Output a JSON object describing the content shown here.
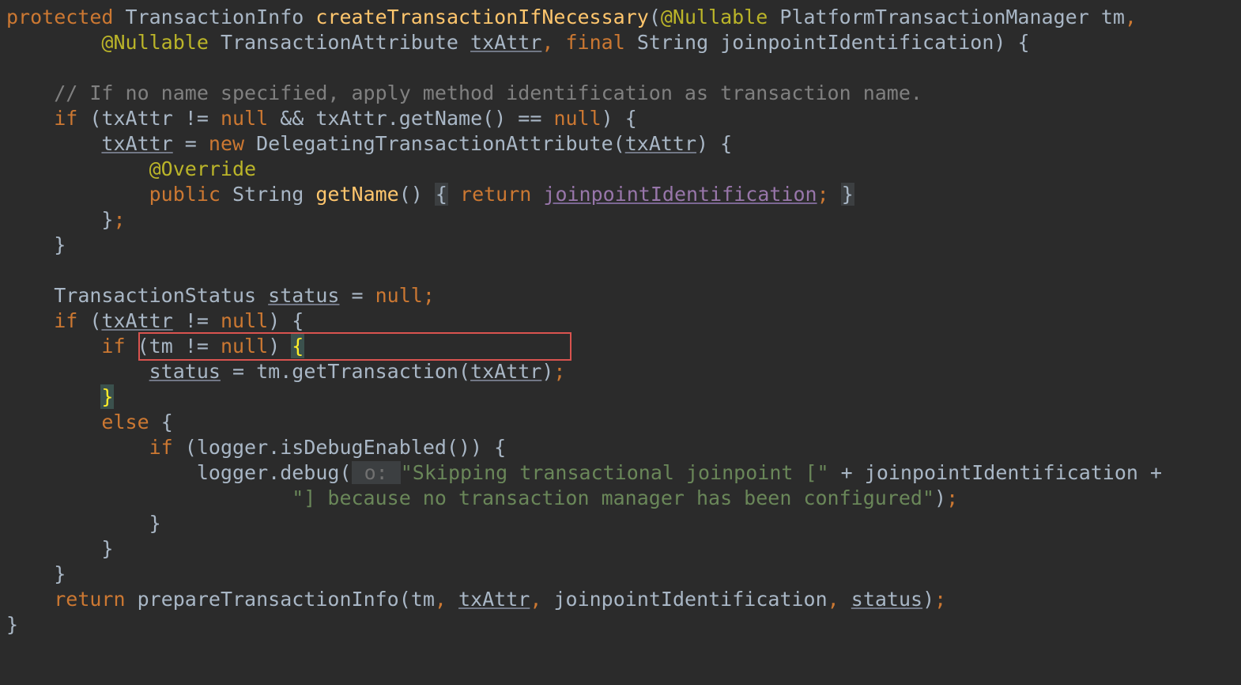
{
  "tokens": {
    "kw_protected": "protected",
    "type_TransactionInfo": "TransactionInfo",
    "m_createTransactionIfNecessary": "createTransactionIfNecessary",
    "ann_Nullable1": "@Nullable",
    "type_PlatformTransactionManager": "PlatformTransactionManager",
    "id_tm": "tm",
    "ann_Nullable2": "@Nullable",
    "type_TransactionAttribute": "TransactionAttribute",
    "id_txAttr_sig": "txAttr",
    "kw_final": "final",
    "type_String_sig": "String",
    "id_joinpointIdentification_sig": "joinpointIdentification",
    "comment1": "// If no name specified, apply method identification as transaction name.",
    "kw_if1": "if",
    "id_txAttr1": "txAttr",
    "kw_null1": "null",
    "id_txAttr2": "txAttr",
    "m_getName_call": "getName",
    "kw_null2": "null",
    "id_txAttr3": "txAttr",
    "kw_new": "new",
    "type_DelegatingTransactionAttribute": "DelegatingTransactionAttribute",
    "id_txAttr4": "txAttr",
    "ann_Override": "@Override",
    "kw_public": "public",
    "type_String2": "String",
    "m_getName_def": "getName",
    "kw_return1": "return",
    "id_joinpointIdentification_ret": "joinpointIdentification",
    "type_TransactionStatus": "TransactionStatus",
    "id_status_decl": "status",
    "kw_null3": "null",
    "kw_if2": "if",
    "id_txAttr5": "txAttr",
    "kw_null4": "null",
    "kw_if3": "if",
    "id_tm2": "tm",
    "kw_null5": "null",
    "id_status_assign": "status",
    "id_tm3": "tm",
    "m_getTransaction": "getTransaction",
    "id_txAttr6": "txAttr",
    "kw_else": "else",
    "kw_if4": "if",
    "id_logger1": "logger",
    "m_isDebugEnabled": "isDebugEnabled",
    "id_logger2": "logger",
    "m_debug": "debug",
    "hint_o": " o: ",
    "str1": "\"Skipping transactional joinpoint [\"",
    "id_joinpointIdentification2": "joinpointIdentification",
    "str2": "\"] because no transaction manager has been configured\"",
    "kw_return2": "return",
    "m_prepareTransactionInfo": "prepareTransactionInfo",
    "id_tm4": "tm",
    "id_txAttr7": "txAttr",
    "id_joinpointIdentification3": "joinpointIdentification",
    "id_status2": "status"
  }
}
